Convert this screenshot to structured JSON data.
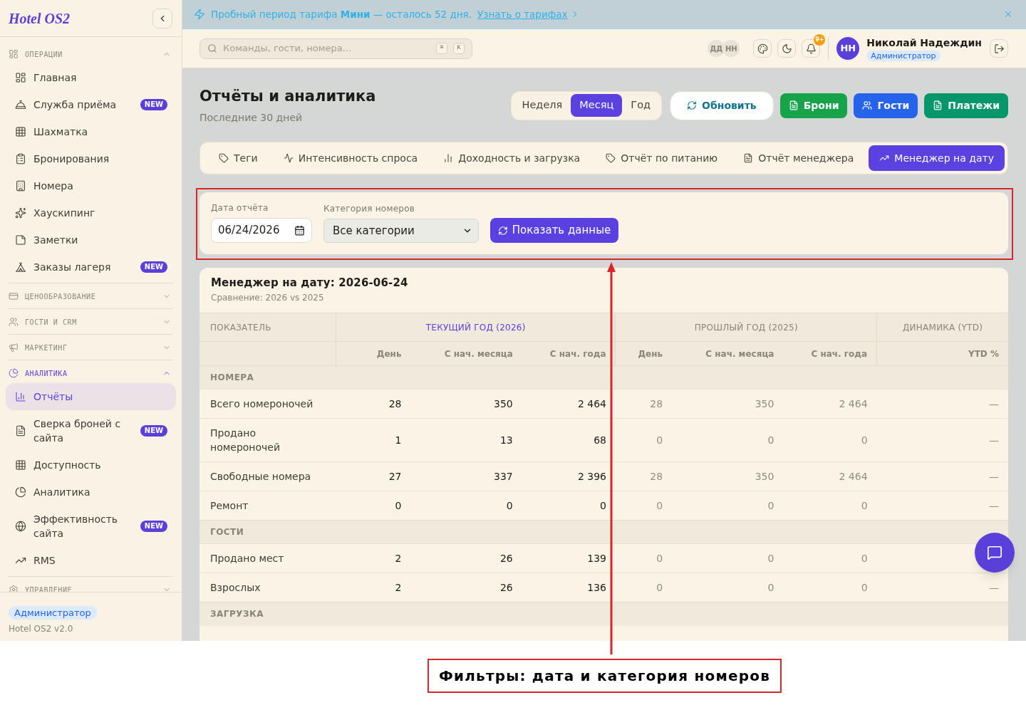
{
  "sidebar": {
    "logo": "Hotel OS2",
    "sections": [
      {
        "title": "ОПЕРАЦИИ",
        "expanded": true,
        "selected": false,
        "items": [
          {
            "label": "Главная",
            "selected": false
          },
          {
            "label": "Служба приёма",
            "badge": "NEW",
            "selected": false
          },
          {
            "label": "Шахматка",
            "selected": false
          },
          {
            "label": "Бронирования",
            "selected": false
          },
          {
            "label": "Номера",
            "selected": false
          },
          {
            "label": "Хаускипинг",
            "selected": false
          },
          {
            "label": "Заметки",
            "selected": false
          },
          {
            "label": "Заказы лагеря",
            "badge": "NEW",
            "selected": false
          }
        ]
      },
      {
        "title": "ЦЕНООБРАЗОВАНИЕ",
        "expanded": false,
        "selected": false
      },
      {
        "title": "ГОСТИ И CRM",
        "expanded": false,
        "selected": false
      },
      {
        "title": "МАРКЕТИНГ",
        "expanded": false,
        "selected": false
      },
      {
        "title": "АНАЛИТИКА",
        "expanded": true,
        "selected": true,
        "items": [
          {
            "label": "Отчёты",
            "selected": true
          },
          {
            "label": "Сверка броней с сайта",
            "badge": "NEW",
            "selected": false
          },
          {
            "label": "Доступность",
            "selected": false
          },
          {
            "label": "Аналитика",
            "selected": false
          },
          {
            "label": "Эффективность сайта",
            "badge": "NEW",
            "selected": false
          },
          {
            "label": "RMS",
            "selected": false
          }
        ]
      },
      {
        "title": "УПРАВЛЕНИЕ",
        "expanded": false,
        "selected": false
      }
    ],
    "footer": {
      "role": "Администратор",
      "version": "Hotel OS2 v2.0"
    }
  },
  "banner": {
    "text": "Пробный период тарифа **Мини** — осталось 52 дня.",
    "link": "Узнать о тарифах"
  },
  "header": {
    "search": {
      "placeholder": "Команды, гости, номера...",
      "shortcut": [
        "⌘",
        "K"
      ]
    },
    "presence": [
      "ДД",
      "НН"
    ],
    "notifications_badge": "9+",
    "user": {
      "initials": "НН",
      "name": "Николай Надеждин",
      "role": "Администратор"
    }
  },
  "page": {
    "title": "Отчёты и аналитика",
    "subtitle": "Последние 30 дней",
    "periods": [
      {
        "label": "Неделя",
        "selected": false
      },
      {
        "label": "Месяц",
        "selected": true
      },
      {
        "label": "Год",
        "selected": false
      }
    ],
    "actions": [
      {
        "label": "Обновить",
        "kind": "refresh"
      },
      {
        "label": "Брони",
        "kind": "bookings"
      },
      {
        "label": "Гости",
        "kind": "guests"
      },
      {
        "label": "Платежи",
        "kind": "payments"
      }
    ]
  },
  "report_tabs": [
    {
      "label": "Теги",
      "selected": false
    },
    {
      "label": "Интенсивность спроса",
      "selected": false
    },
    {
      "label": "Доходность и загрузка",
      "selected": false
    },
    {
      "label": "Отчёт по питанию",
      "selected": false
    },
    {
      "label": "Отчёт менеджера",
      "selected": false
    },
    {
      "label": "Менеджер на дату",
      "selected": true
    }
  ],
  "filters": {
    "date": {
      "label": "Дата отчёта",
      "value": "06/24/2026"
    },
    "category": {
      "label": "Категория номеров",
      "value": "Все категории"
    },
    "submit": "Показать данные"
  },
  "report": {
    "title": "Менеджер на дату: 2026-06-24",
    "subtitle": "Сравнение: 2026 vs 2025",
    "indicator_header": "ПОКАЗАТЕЛЬ",
    "groups": [
      {
        "label": "ТЕКУЩИЙ ГОД (2026)",
        "highlighted": true,
        "columns": [
          "День",
          "С нач. месяца",
          "С нач. года"
        ]
      },
      {
        "label": "ПРОШЛЫЙ ГОД (2025)",
        "highlighted": false,
        "columns": [
          "День",
          "С нач. месяца",
          "С нач. года"
        ]
      },
      {
        "label": "ДИНАМИКА (YTD)",
        "highlighted": false,
        "columns": [
          "YTD %"
        ]
      }
    ],
    "sections": [
      {
        "title": "НОМЕРА",
        "rows": [
          {
            "label": "Всего номероночей",
            "current": [
              "28",
              "350",
              "2 464"
            ],
            "previous": [
              "28",
              "350",
              "2 464"
            ],
            "dynamics": [
              "—"
            ]
          },
          {
            "label": "Продано номероночей",
            "current": [
              "1",
              "13",
              "68"
            ],
            "previous": [
              "0",
              "0",
              "0"
            ],
            "dynamics": [
              "—"
            ]
          },
          {
            "label": "Свободные номера",
            "current": [
              "27",
              "337",
              "2 396"
            ],
            "previous": [
              "28",
              "350",
              "2 464"
            ],
            "dynamics": [
              "—"
            ]
          },
          {
            "label": "Ремонт",
            "current": [
              "0",
              "0",
              "0"
            ],
            "previous": [
              "0",
              "0",
              "0"
            ],
            "dynamics": [
              "—"
            ]
          }
        ]
      },
      {
        "title": "ГОСТИ",
        "rows": [
          {
            "label": "Продано мест",
            "current": [
              "2",
              "26",
              "139"
            ],
            "previous": [
              "0",
              "0",
              "0"
            ]
          },
          {
            "label": "Взрослых",
            "current": [
              "2",
              "26",
              "136"
            ],
            "previous": [
              "0",
              "0",
              "0"
            ],
            "dynamics": [
              "—"
            ]
          }
        ]
      },
      {
        "title": "ЗАГРУЗКА"
      }
    ]
  },
  "annotation": {
    "caption": "Фильтры: дата и категория номеров"
  }
}
